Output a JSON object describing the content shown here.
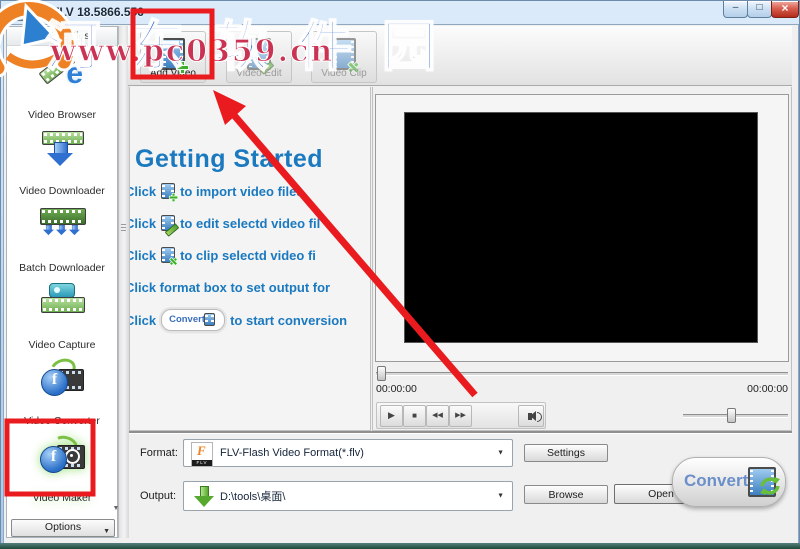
{
  "window": {
    "title": "GetFLV 18.5866.556"
  },
  "watermark": {
    "site_name": "河东软件园",
    "site_url": "www.pc0359.cn"
  },
  "sidebar": {
    "header": "FLV Utilities",
    "items": [
      "Video Browser",
      "Video Downloader",
      "Batch Downloader",
      "Video Capture",
      "Video Converter",
      "Video Maker"
    ],
    "options_label": "Options"
  },
  "toolbar": {
    "add_video": "Add Video",
    "video_edit": "Video Edit",
    "video_clip": "Video Clip"
  },
  "getting_started": {
    "title": "Getting Started",
    "steps": [
      {
        "pre": "Click",
        "post": "to import video files"
      },
      {
        "pre": "Click",
        "post": "to edit selectd video fil"
      },
      {
        "pre": "Click",
        "post": "to clip selectd video fi"
      },
      {
        "pre": "Click format box to set output for",
        "post": ""
      },
      {
        "pre": "Click",
        "post": "to start conversion"
      }
    ],
    "convert_pill_label": "Convert"
  },
  "player": {
    "elapsed": "00:00:00",
    "duration": "00:00:00"
  },
  "bottom": {
    "format_label": "Format:",
    "format_value": "FLV-Flash Video Format(*.flv)",
    "output_label": "Output:",
    "output_value": "D:\\tools\\桌面\\",
    "settings_label": "Settings",
    "browse_label": "Browse",
    "open_label": "Open",
    "convert_label": "Convert",
    "flv_icon_text": "FLV"
  },
  "icons": {
    "dropdown": "▼",
    "play": "▶",
    "stop": "■",
    "previous": "◀◀",
    "next": "▶▶",
    "minimize": "–",
    "maximize": "□",
    "close": "×",
    "options_arrow": "▼",
    "scroll_down": "▼"
  },
  "colors": {
    "annotation_red": "#ea1b1e",
    "heading_blue": "#1a79bf",
    "watermark_blue": "#2e63cf",
    "watermark_red": "#cb3354",
    "convert_text_blue": "#6b8fc9"
  }
}
